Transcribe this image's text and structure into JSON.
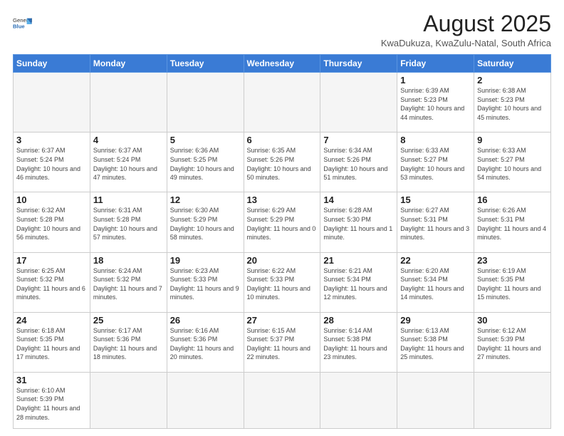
{
  "header": {
    "logo_general": "General",
    "logo_blue": "Blue",
    "month_title": "August 2025",
    "location": "KwaDukuza, KwaZulu-Natal, South Africa"
  },
  "days_of_week": [
    "Sunday",
    "Monday",
    "Tuesday",
    "Wednesday",
    "Thursday",
    "Friday",
    "Saturday"
  ],
  "weeks": [
    [
      {
        "day": "",
        "info": ""
      },
      {
        "day": "",
        "info": ""
      },
      {
        "day": "",
        "info": ""
      },
      {
        "day": "",
        "info": ""
      },
      {
        "day": "",
        "info": ""
      },
      {
        "day": "1",
        "info": "Sunrise: 6:39 AM\nSunset: 5:23 PM\nDaylight: 10 hours\nand 44 minutes."
      },
      {
        "day": "2",
        "info": "Sunrise: 6:38 AM\nSunset: 5:23 PM\nDaylight: 10 hours\nand 45 minutes."
      }
    ],
    [
      {
        "day": "3",
        "info": "Sunrise: 6:37 AM\nSunset: 5:24 PM\nDaylight: 10 hours\nand 46 minutes."
      },
      {
        "day": "4",
        "info": "Sunrise: 6:37 AM\nSunset: 5:24 PM\nDaylight: 10 hours\nand 47 minutes."
      },
      {
        "day": "5",
        "info": "Sunrise: 6:36 AM\nSunset: 5:25 PM\nDaylight: 10 hours\nand 49 minutes."
      },
      {
        "day": "6",
        "info": "Sunrise: 6:35 AM\nSunset: 5:26 PM\nDaylight: 10 hours\nand 50 minutes."
      },
      {
        "day": "7",
        "info": "Sunrise: 6:34 AM\nSunset: 5:26 PM\nDaylight: 10 hours\nand 51 minutes."
      },
      {
        "day": "8",
        "info": "Sunrise: 6:33 AM\nSunset: 5:27 PM\nDaylight: 10 hours\nand 53 minutes."
      },
      {
        "day": "9",
        "info": "Sunrise: 6:33 AM\nSunset: 5:27 PM\nDaylight: 10 hours\nand 54 minutes."
      }
    ],
    [
      {
        "day": "10",
        "info": "Sunrise: 6:32 AM\nSunset: 5:28 PM\nDaylight: 10 hours\nand 56 minutes."
      },
      {
        "day": "11",
        "info": "Sunrise: 6:31 AM\nSunset: 5:28 PM\nDaylight: 10 hours\nand 57 minutes."
      },
      {
        "day": "12",
        "info": "Sunrise: 6:30 AM\nSunset: 5:29 PM\nDaylight: 10 hours\nand 58 minutes."
      },
      {
        "day": "13",
        "info": "Sunrise: 6:29 AM\nSunset: 5:29 PM\nDaylight: 11 hours\nand 0 minutes."
      },
      {
        "day": "14",
        "info": "Sunrise: 6:28 AM\nSunset: 5:30 PM\nDaylight: 11 hours\nand 1 minute."
      },
      {
        "day": "15",
        "info": "Sunrise: 6:27 AM\nSunset: 5:31 PM\nDaylight: 11 hours\nand 3 minutes."
      },
      {
        "day": "16",
        "info": "Sunrise: 6:26 AM\nSunset: 5:31 PM\nDaylight: 11 hours\nand 4 minutes."
      }
    ],
    [
      {
        "day": "17",
        "info": "Sunrise: 6:25 AM\nSunset: 5:32 PM\nDaylight: 11 hours\nand 6 minutes."
      },
      {
        "day": "18",
        "info": "Sunrise: 6:24 AM\nSunset: 5:32 PM\nDaylight: 11 hours\nand 7 minutes."
      },
      {
        "day": "19",
        "info": "Sunrise: 6:23 AM\nSunset: 5:33 PM\nDaylight: 11 hours\nand 9 minutes."
      },
      {
        "day": "20",
        "info": "Sunrise: 6:22 AM\nSunset: 5:33 PM\nDaylight: 11 hours\nand 10 minutes."
      },
      {
        "day": "21",
        "info": "Sunrise: 6:21 AM\nSunset: 5:34 PM\nDaylight: 11 hours\nand 12 minutes."
      },
      {
        "day": "22",
        "info": "Sunrise: 6:20 AM\nSunset: 5:34 PM\nDaylight: 11 hours\nand 14 minutes."
      },
      {
        "day": "23",
        "info": "Sunrise: 6:19 AM\nSunset: 5:35 PM\nDaylight: 11 hours\nand 15 minutes."
      }
    ],
    [
      {
        "day": "24",
        "info": "Sunrise: 6:18 AM\nSunset: 5:35 PM\nDaylight: 11 hours\nand 17 minutes."
      },
      {
        "day": "25",
        "info": "Sunrise: 6:17 AM\nSunset: 5:36 PM\nDaylight: 11 hours\nand 18 minutes."
      },
      {
        "day": "26",
        "info": "Sunrise: 6:16 AM\nSunset: 5:36 PM\nDaylight: 11 hours\nand 20 minutes."
      },
      {
        "day": "27",
        "info": "Sunrise: 6:15 AM\nSunset: 5:37 PM\nDaylight: 11 hours\nand 22 minutes."
      },
      {
        "day": "28",
        "info": "Sunrise: 6:14 AM\nSunset: 5:38 PM\nDaylight: 11 hours\nand 23 minutes."
      },
      {
        "day": "29",
        "info": "Sunrise: 6:13 AM\nSunset: 5:38 PM\nDaylight: 11 hours\nand 25 minutes."
      },
      {
        "day": "30",
        "info": "Sunrise: 6:12 AM\nSunset: 5:39 PM\nDaylight: 11 hours\nand 27 minutes."
      }
    ],
    [
      {
        "day": "31",
        "info": "Sunrise: 6:10 AM\nSunset: 5:39 PM\nDaylight: 11 hours\nand 28 minutes."
      },
      {
        "day": "",
        "info": ""
      },
      {
        "day": "",
        "info": ""
      },
      {
        "day": "",
        "info": ""
      },
      {
        "day": "",
        "info": ""
      },
      {
        "day": "",
        "info": ""
      },
      {
        "day": "",
        "info": ""
      }
    ]
  ]
}
